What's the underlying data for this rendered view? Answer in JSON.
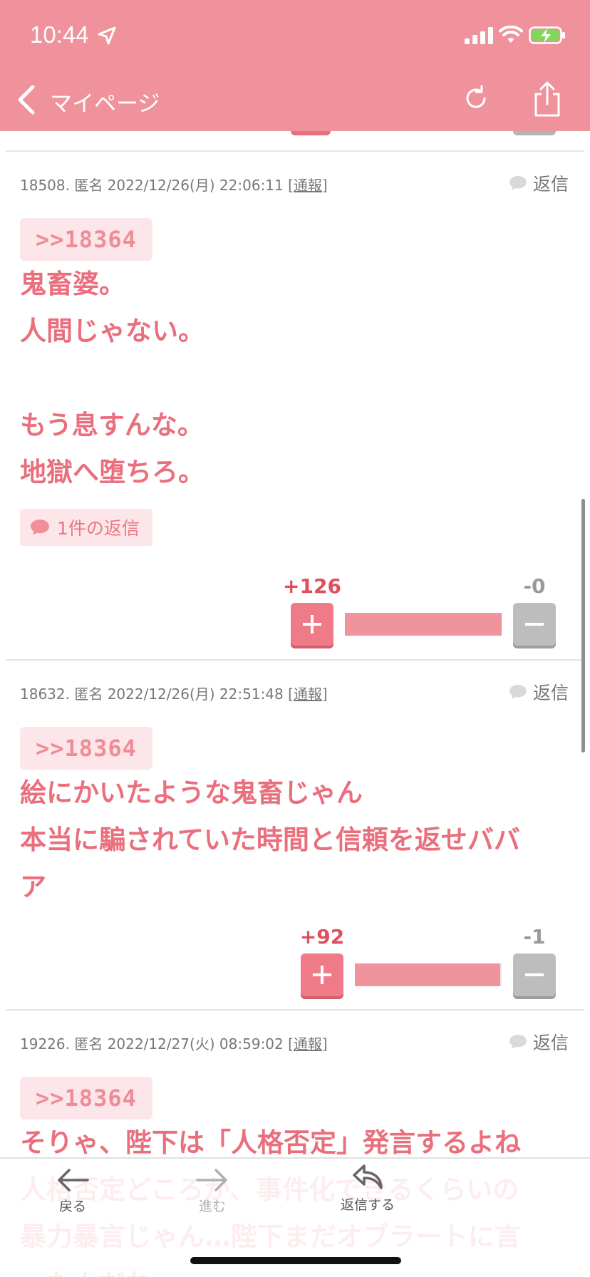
{
  "status_bar": {
    "time": "10:44"
  },
  "nav": {
    "back_label": "マイページ"
  },
  "posts": [
    {
      "meta_prefix": "18508. 匿名 2022/12/26(月) 22:06:11 [",
      "report_label": "通報",
      "meta_suffix": "]",
      "reply_label": "返信",
      "anchor": ">>18364",
      "body": "鬼畜婆。\n人間じゃない。\n\nもう息すんな。\n地獄へ堕ちろ。",
      "reply_count_label": "1件の返信",
      "plus_votes": "+126",
      "minus_votes": "-0",
      "vote_ratio": 1.0
    },
    {
      "meta_prefix": "18632. 匿名 2022/12/26(月) 22:51:48 [",
      "report_label": "通報",
      "meta_suffix": "]",
      "reply_label": "返信",
      "anchor": ">>18364",
      "body": "絵にかいたような鬼畜じゃん\n本当に騙されていた時間と信頼を返せババ\nア",
      "plus_votes": "+92",
      "minus_votes": "-1",
      "vote_ratio": 0.989
    },
    {
      "meta_prefix": "19226. 匿名 2022/12/27(火) 08:59:02 [",
      "report_label": "通報",
      "meta_suffix": "]",
      "reply_label": "返信",
      "anchor": ">>18364",
      "body": "そりゃ、陛下は「人格否定」発言するよね\n人格否定どころか、事件化できるくらいの\n暴力暴言じゃん…陛下まだオブラートに言\nったんだね"
    }
  ],
  "toolbar": {
    "back": "戻る",
    "forward": "進む",
    "reply": "返信する"
  },
  "colors": {
    "header_bg": "#ef929b",
    "body_text": "#ea6f7d",
    "plus_vote": "#e04f5e",
    "minus_vote": "#9a9a9a"
  }
}
